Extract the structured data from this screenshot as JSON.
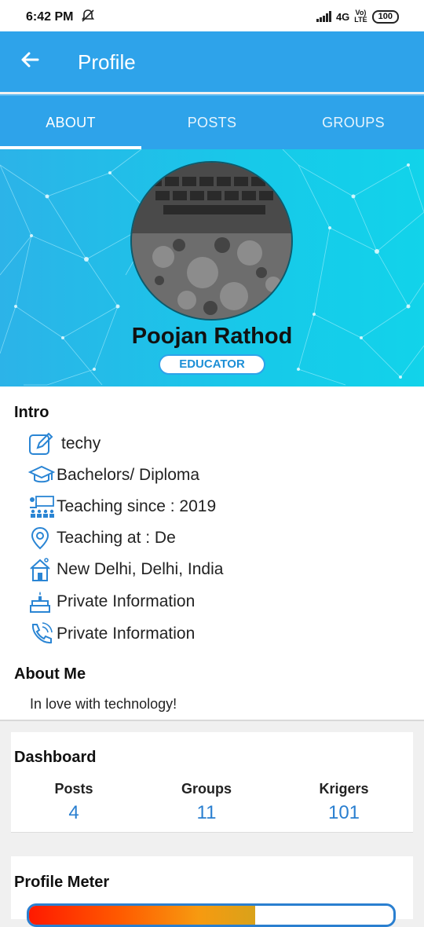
{
  "status": {
    "time": "6:42 PM",
    "network": "4G",
    "lte": "LTE",
    "volte": "Vo)",
    "battery": "100"
  },
  "appbar": {
    "title": "Profile"
  },
  "tabs": [
    {
      "label": "ABOUT",
      "active": true
    },
    {
      "label": "POSTS",
      "active": false
    },
    {
      "label": "GROUPS",
      "active": false
    }
  ],
  "profile": {
    "name": "Poojan Rathod",
    "role": "EDUCATOR"
  },
  "intro": {
    "heading": "Intro",
    "items": [
      {
        "icon": "edit-icon",
        "text": "techy"
      },
      {
        "icon": "graduation-cap-icon",
        "text": "Bachelors/ Diploma"
      },
      {
        "icon": "classroom-icon",
        "text": "Teaching since : 2019"
      },
      {
        "icon": "location-pin-icon",
        "text": "Teaching at : De"
      },
      {
        "icon": "home-icon",
        "text": "New Delhi, Delhi, India"
      },
      {
        "icon": "birthday-cake-icon",
        "text": "Private Information"
      },
      {
        "icon": "phone-icon",
        "text": "Private Information"
      }
    ]
  },
  "about_me": {
    "heading": "About Me",
    "text": "In love with technology!"
  },
  "dashboard": {
    "heading": "Dashboard",
    "stats": [
      {
        "label": "Posts",
        "value": "4"
      },
      {
        "label": "Groups",
        "value": "11"
      },
      {
        "label": "Krigers",
        "value": "101"
      }
    ]
  },
  "profile_meter": {
    "heading": "Profile Meter",
    "progress": 0.62
  },
  "colors": {
    "primary": "#2ea3ea",
    "accent_text": "#2a7fd0"
  }
}
